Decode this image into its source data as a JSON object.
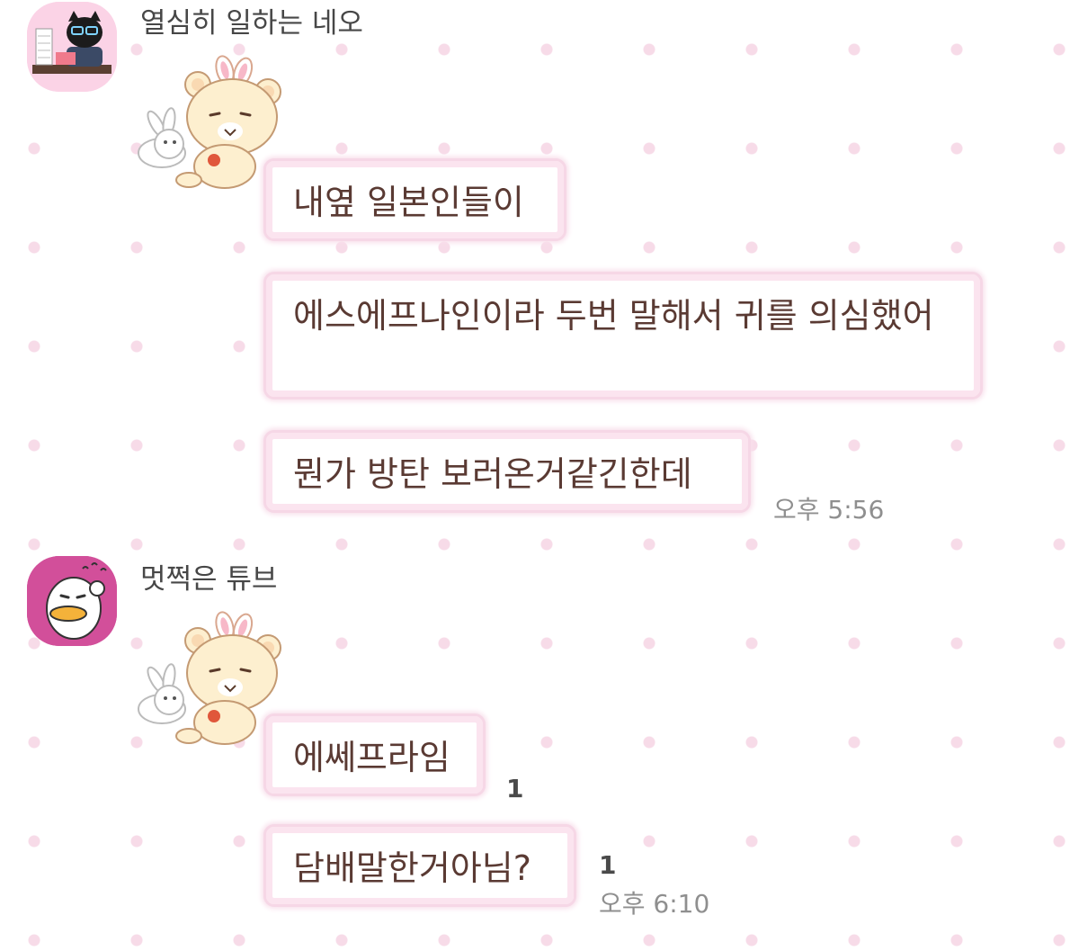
{
  "chat": {
    "messages_group_1": {
      "sender": "열심히 일하는 네오",
      "sticker": "rilakkuma-bunny-sticker",
      "bubbles": [
        "내옆 일본인들이",
        "에스에프나인이라 두번 말해서 귀를 의심했어",
        "뭔가 방탄 보러온거같긴한데"
      ],
      "time": "오후 5:56"
    },
    "messages_group_2": {
      "sender": "멋쩍은 튜브",
      "sticker": "rilakkuma-bunny-sticker",
      "bubbles": [
        "에쎄프라임",
        "담배말한거아님?"
      ],
      "unread_1": "1",
      "unread_2": "1",
      "time": "오후 6:10"
    }
  },
  "colors": {
    "bubble_border": "#f6d7e6",
    "dot_pattern": "#f7dbe8",
    "text": "#5a3a33",
    "tube_avatar_bg": "#d24f9a",
    "neo_avatar_bg": "#fbd3e6"
  },
  "icons": {
    "avatar_1": "neo-working-avatar",
    "avatar_2": "tube-avatar"
  }
}
